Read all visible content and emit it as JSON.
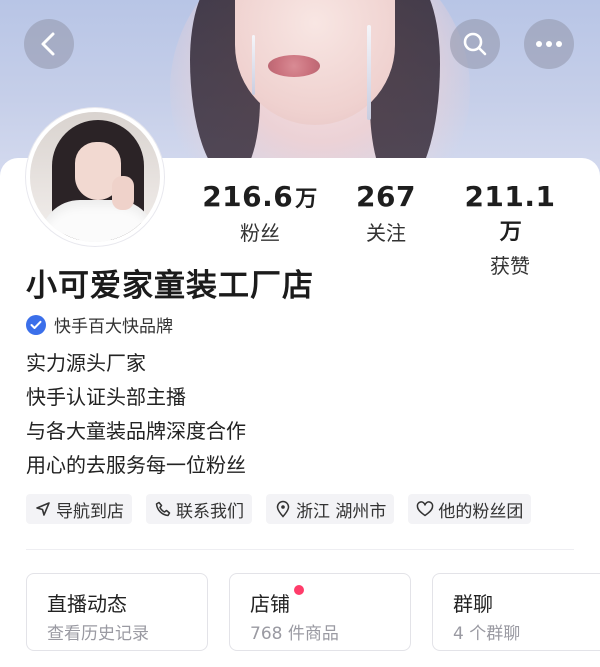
{
  "header": {
    "back_icon": "chevron-left-icon",
    "search_icon": "search-icon",
    "more_icon": "more-horizontal-icon"
  },
  "profile": {
    "stats": [
      {
        "value": "216.6",
        "unit": "万",
        "label": "粉丝"
      },
      {
        "value": "267",
        "unit": "",
        "label": "关注"
      },
      {
        "value": "211.1",
        "unit": "万",
        "label": "获赞"
      }
    ],
    "shop_name": "小可爱家童装工厂店",
    "verification": {
      "icon": "verified-check-icon",
      "text": "快手百大快品牌",
      "color": "#3b6fea"
    },
    "bio": [
      "实力源头厂家",
      "快手认证头部主播",
      "与各大童装品牌深度合作",
      "用心的去服务每一位粉丝"
    ]
  },
  "tags": [
    {
      "icon": "navigation-arrow-icon",
      "label": "导航到店"
    },
    {
      "icon": "phone-icon",
      "label": "联系我们"
    },
    {
      "icon": "location-pin-icon",
      "label": "浙江 湖州市"
    },
    {
      "icon": "heart-icon",
      "label": "他的粉丝团"
    }
  ],
  "entries": [
    {
      "title": "直播动态",
      "subtitle": "查看历史记录"
    },
    {
      "title": "店铺",
      "subtitle": "768 件商品",
      "has_dot": true,
      "dot_color": "#ff3c6a"
    },
    {
      "title": "群聊",
      "subtitle": "4 个群聊"
    }
  ]
}
